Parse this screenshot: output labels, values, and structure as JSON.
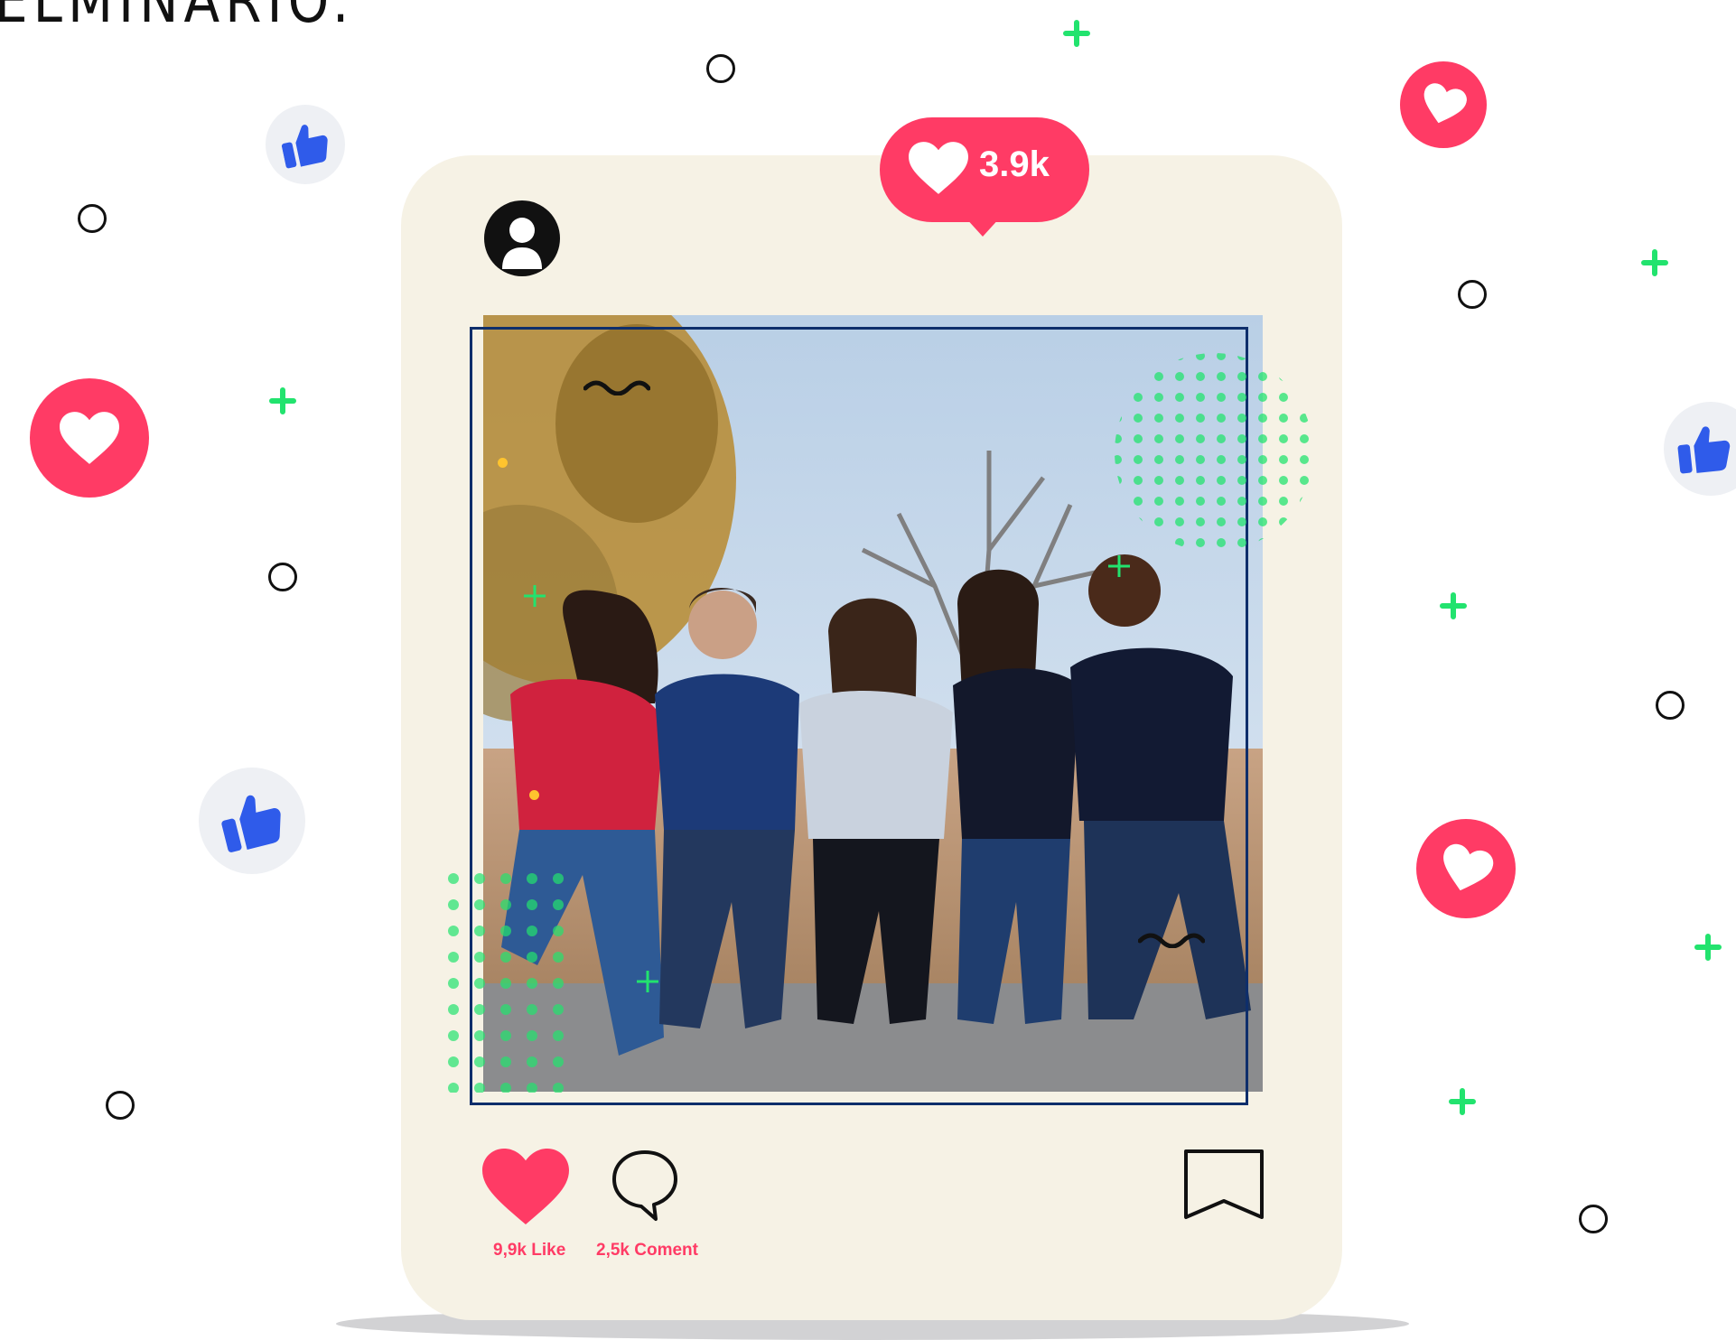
{
  "header_text": "ELMINARIO.",
  "post": {
    "likes_popup": "3.9k",
    "like_stat": "9,9k Like",
    "comment_stat": "2,5k Coment"
  },
  "colors": {
    "accent_pink": "#ff3b65",
    "like_blue": "#2f5bea",
    "plus_green": "#22e36e",
    "card_bg": "#f6f2e5",
    "frame_navy": "#0e2e6b"
  },
  "icons": [
    "user-avatar-icon",
    "heart-icon",
    "comment-icon",
    "bookmark-icon",
    "thumbs-up-icon"
  ]
}
